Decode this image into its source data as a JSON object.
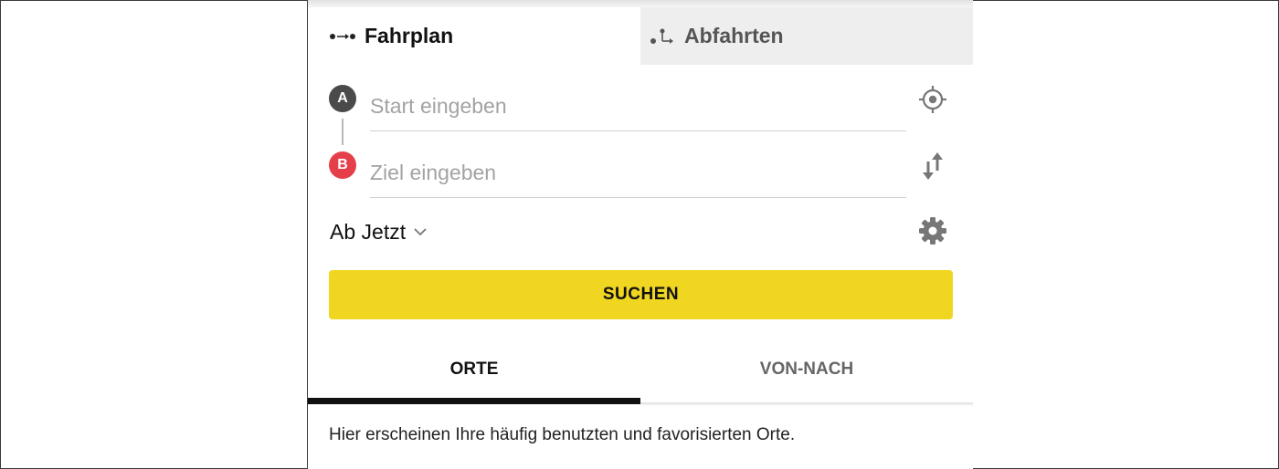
{
  "mode_tabs": {
    "timetable": {
      "label": "Fahrplan",
      "icon": "route-icon"
    },
    "departures": {
      "label": "Abfahrten",
      "icon": "departures-icon"
    }
  },
  "form": {
    "start": {
      "badge": "A",
      "placeholder": "Start eingeben",
      "value": ""
    },
    "destination": {
      "badge": "B",
      "placeholder": "Ziel eingeben",
      "value": ""
    },
    "when_label": "Ab Jetzt",
    "search_label": "SUCHEN"
  },
  "list_tabs": {
    "places": "ORTE",
    "from_to": "VON-NACH",
    "active": "places"
  },
  "hint_text": "Hier erscheinen Ihre häufig benutzten und favorisierten Orte.",
  "colors": {
    "accent_yellow": "#f0d621",
    "badge_a": "#4a4a4a",
    "badge_b": "#e5404a"
  }
}
